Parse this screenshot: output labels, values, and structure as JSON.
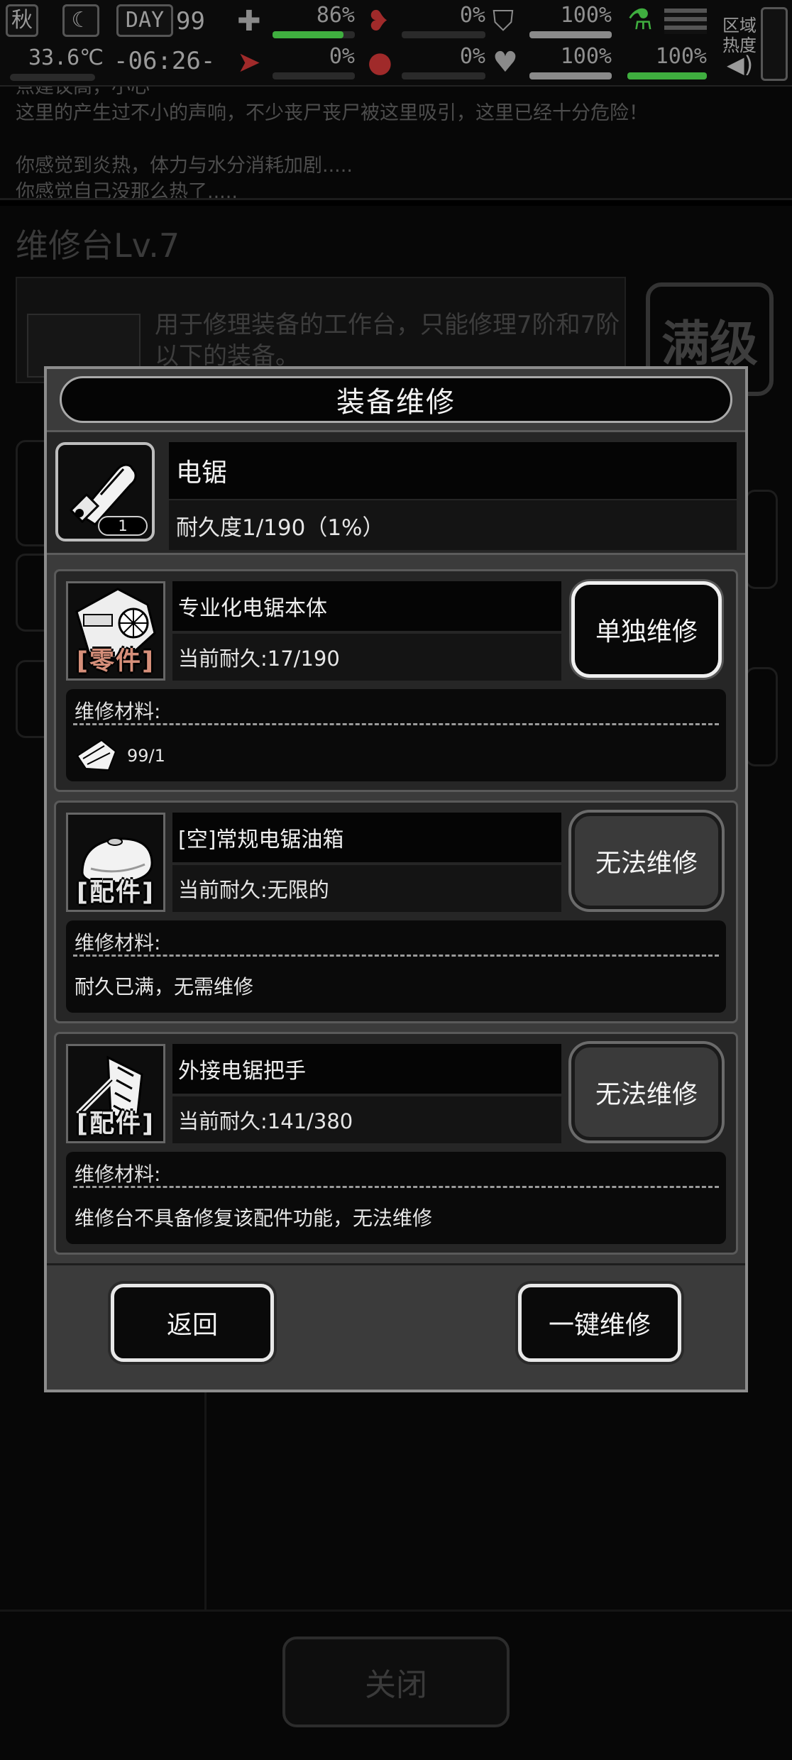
{
  "status_bar": {
    "season": "秋",
    "temperature": "33.6℃",
    "day_label": "DAY",
    "day_number": "99",
    "clock": "-06:26-",
    "stats": [
      {
        "id": "health",
        "percent": "86%",
        "fill": 0.86,
        "color": "#3fae3f"
      },
      {
        "id": "hunger",
        "percent": "0%",
        "fill": 0.0,
        "color": "#b03030"
      },
      {
        "id": "armor",
        "percent": "100%",
        "fill": 1.0,
        "color": "#8a8a8a"
      },
      {
        "id": "stamina",
        "percent": "0%",
        "fill": 0.0,
        "color": "#b03030"
      },
      {
        "id": "water",
        "percent": "0%",
        "fill": 0.0,
        "color": "#b03030"
      },
      {
        "id": "heart",
        "percent": "100%",
        "fill": 1.0,
        "color": "#8a8a8a"
      },
      {
        "id": "energy",
        "percent": "100%",
        "fill": 1.0,
        "color": "#3fae3f"
      }
    ],
    "zone_label_1": "区域",
    "zone_label_2": "热度"
  },
  "background": {
    "log_lines": [
      "点建议高，小心",
      "这里的产生过不小的声响，不少丧尸丧尸被这里吸引，这里已经十分危险！",
      "",
      "你感觉到炎热，体力与水分消耗加剧.....",
      "你感觉自己没那么热了....."
    ],
    "title": "维修台Lv.7",
    "description": "用于修理装备的工作台，只能修理7阶和7阶以下的装备。",
    "max_level_stamp": "满级",
    "close_label": "关闭"
  },
  "modal": {
    "title": "装备维修",
    "item": {
      "name": "电锯",
      "durability": "耐久度1/190（1%）",
      "count": "1"
    },
    "parts": [
      {
        "name": "专业化电锯本体",
        "tag": "零件",
        "durability": "当前耐久:17/190",
        "button": "单独维修",
        "button_enabled": true,
        "materials_label": "维修材料:",
        "material_count": "99/1",
        "material_text": ""
      },
      {
        "name": "[空]常规电锯油箱",
        "tag": "配件",
        "durability": "当前耐久:无限的",
        "button": "无法维修",
        "button_enabled": false,
        "materials_label": "维修材料:",
        "material_count": "",
        "material_text": "耐久已满，无需维修"
      },
      {
        "name": "外接电锯把手",
        "tag": "配件",
        "durability": "当前耐久:141/380",
        "button": "无法维修",
        "button_enabled": false,
        "materials_label": "维修材料:",
        "material_count": "",
        "material_text": "维修台不具备修复该配件功能，无法维修"
      }
    ],
    "back_label": "返回",
    "repair_all_label": "一键维修"
  }
}
